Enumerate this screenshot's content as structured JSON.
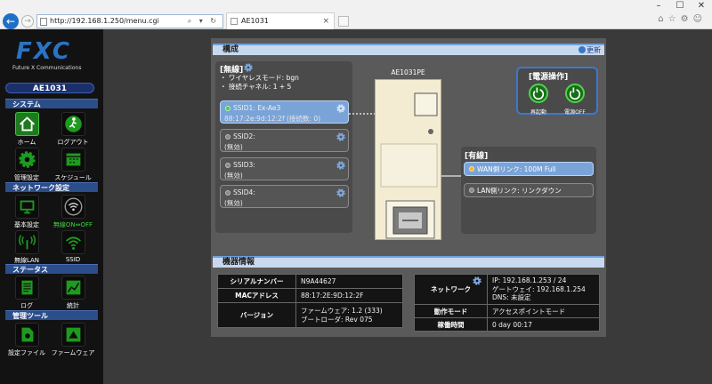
{
  "browser": {
    "window_controls": [
      "–",
      "☐",
      "✕"
    ],
    "url": "http://192.168.1.250/menu.cgi",
    "addr_controls": "⌕ ▾ ↻",
    "tab_title": "AE1031",
    "tab_close": "×",
    "toolbar_icons": "⌂☆⚙☺"
  },
  "sidebar": {
    "logo": "FXC",
    "logo_sub": "Future X Communications",
    "model": "AE1031",
    "sections": [
      {
        "label": "システム",
        "items": [
          {
            "label": "ホーム",
            "icon": "home-icon"
          },
          {
            "label": "ログアウト",
            "icon": "logout-icon"
          },
          {
            "label": "管理設定",
            "icon": "gear-icon"
          },
          {
            "label": "スケジュール",
            "icon": "calendar-icon"
          }
        ]
      },
      {
        "label": "ネットワーク設定",
        "items": [
          {
            "label": "基本設定",
            "icon": "monitor-icon"
          },
          {
            "label": "無線ON⇔OFF",
            "icon": "wireless-toggle-icon"
          },
          {
            "label": "無線LAN",
            "icon": "antenna-icon"
          },
          {
            "label": "SSID",
            "icon": "wifi-icon"
          }
        ]
      },
      {
        "label": "ステータス",
        "items": [
          {
            "label": "ログ",
            "icon": "log-icon"
          },
          {
            "label": "統計",
            "icon": "stats-icon"
          }
        ]
      },
      {
        "label": "管理ツール",
        "items": [
          {
            "label": "設定ファイル",
            "icon": "config-file-icon"
          },
          {
            "label": "ファームウェア",
            "icon": "firmware-icon"
          }
        ]
      }
    ]
  },
  "config": {
    "header": "構成",
    "refresh": "更新",
    "wireless": {
      "title": "[無線]",
      "mode": "・ ワイヤレスモード: bgn",
      "channel": "・ 接続チャネル: 1 + 5",
      "ssids": [
        {
          "name": "SSID1: Ex-Ae3",
          "status": "88:17:2e:9d:12:2f (接続数: 0)",
          "active": true
        },
        {
          "name": "SSID2:",
          "status": "(無効)",
          "active": false
        },
        {
          "name": "SSID3:",
          "status": "(無効)",
          "active": false
        },
        {
          "name": "SSID4:",
          "status": "(無効)",
          "active": false
        }
      ]
    },
    "device_name": "AE1031PE",
    "power": {
      "title": "[電源操作]",
      "restart": "再起動",
      "off": "電源OFF"
    },
    "wired": {
      "title": "[有線]",
      "wan": "WAN側リンク: 100M Full",
      "lan": "LAN側リンク: リンクダウン"
    }
  },
  "device_info": {
    "header": "機器情報",
    "left": [
      {
        "key": "シリアルナンバー",
        "value": "N9A44627"
      },
      {
        "key": "MACアドレス",
        "value": "88:17:2E:9D:12:2F"
      },
      {
        "key": "バージョン",
        "value": "ファームウェア: 1.2 (333)\nブートローダ: Rev 075"
      }
    ],
    "network": {
      "key": "ネットワーク",
      "ip": "IP: 192.168.1.253 / 24",
      "gateway": "ゲートウェイ: 192.168.1.254",
      "dns": "DNS: 未設定"
    },
    "right": [
      {
        "key": "動作モード",
        "value": "アクセスポイントモード"
      },
      {
        "key": "稼働時間",
        "value": "0 day 00:17"
      }
    ]
  },
  "colors": {
    "accent_blue": "#2a73c5",
    "status_green": "#3cd43c",
    "status_amber": "#f7b21a"
  }
}
